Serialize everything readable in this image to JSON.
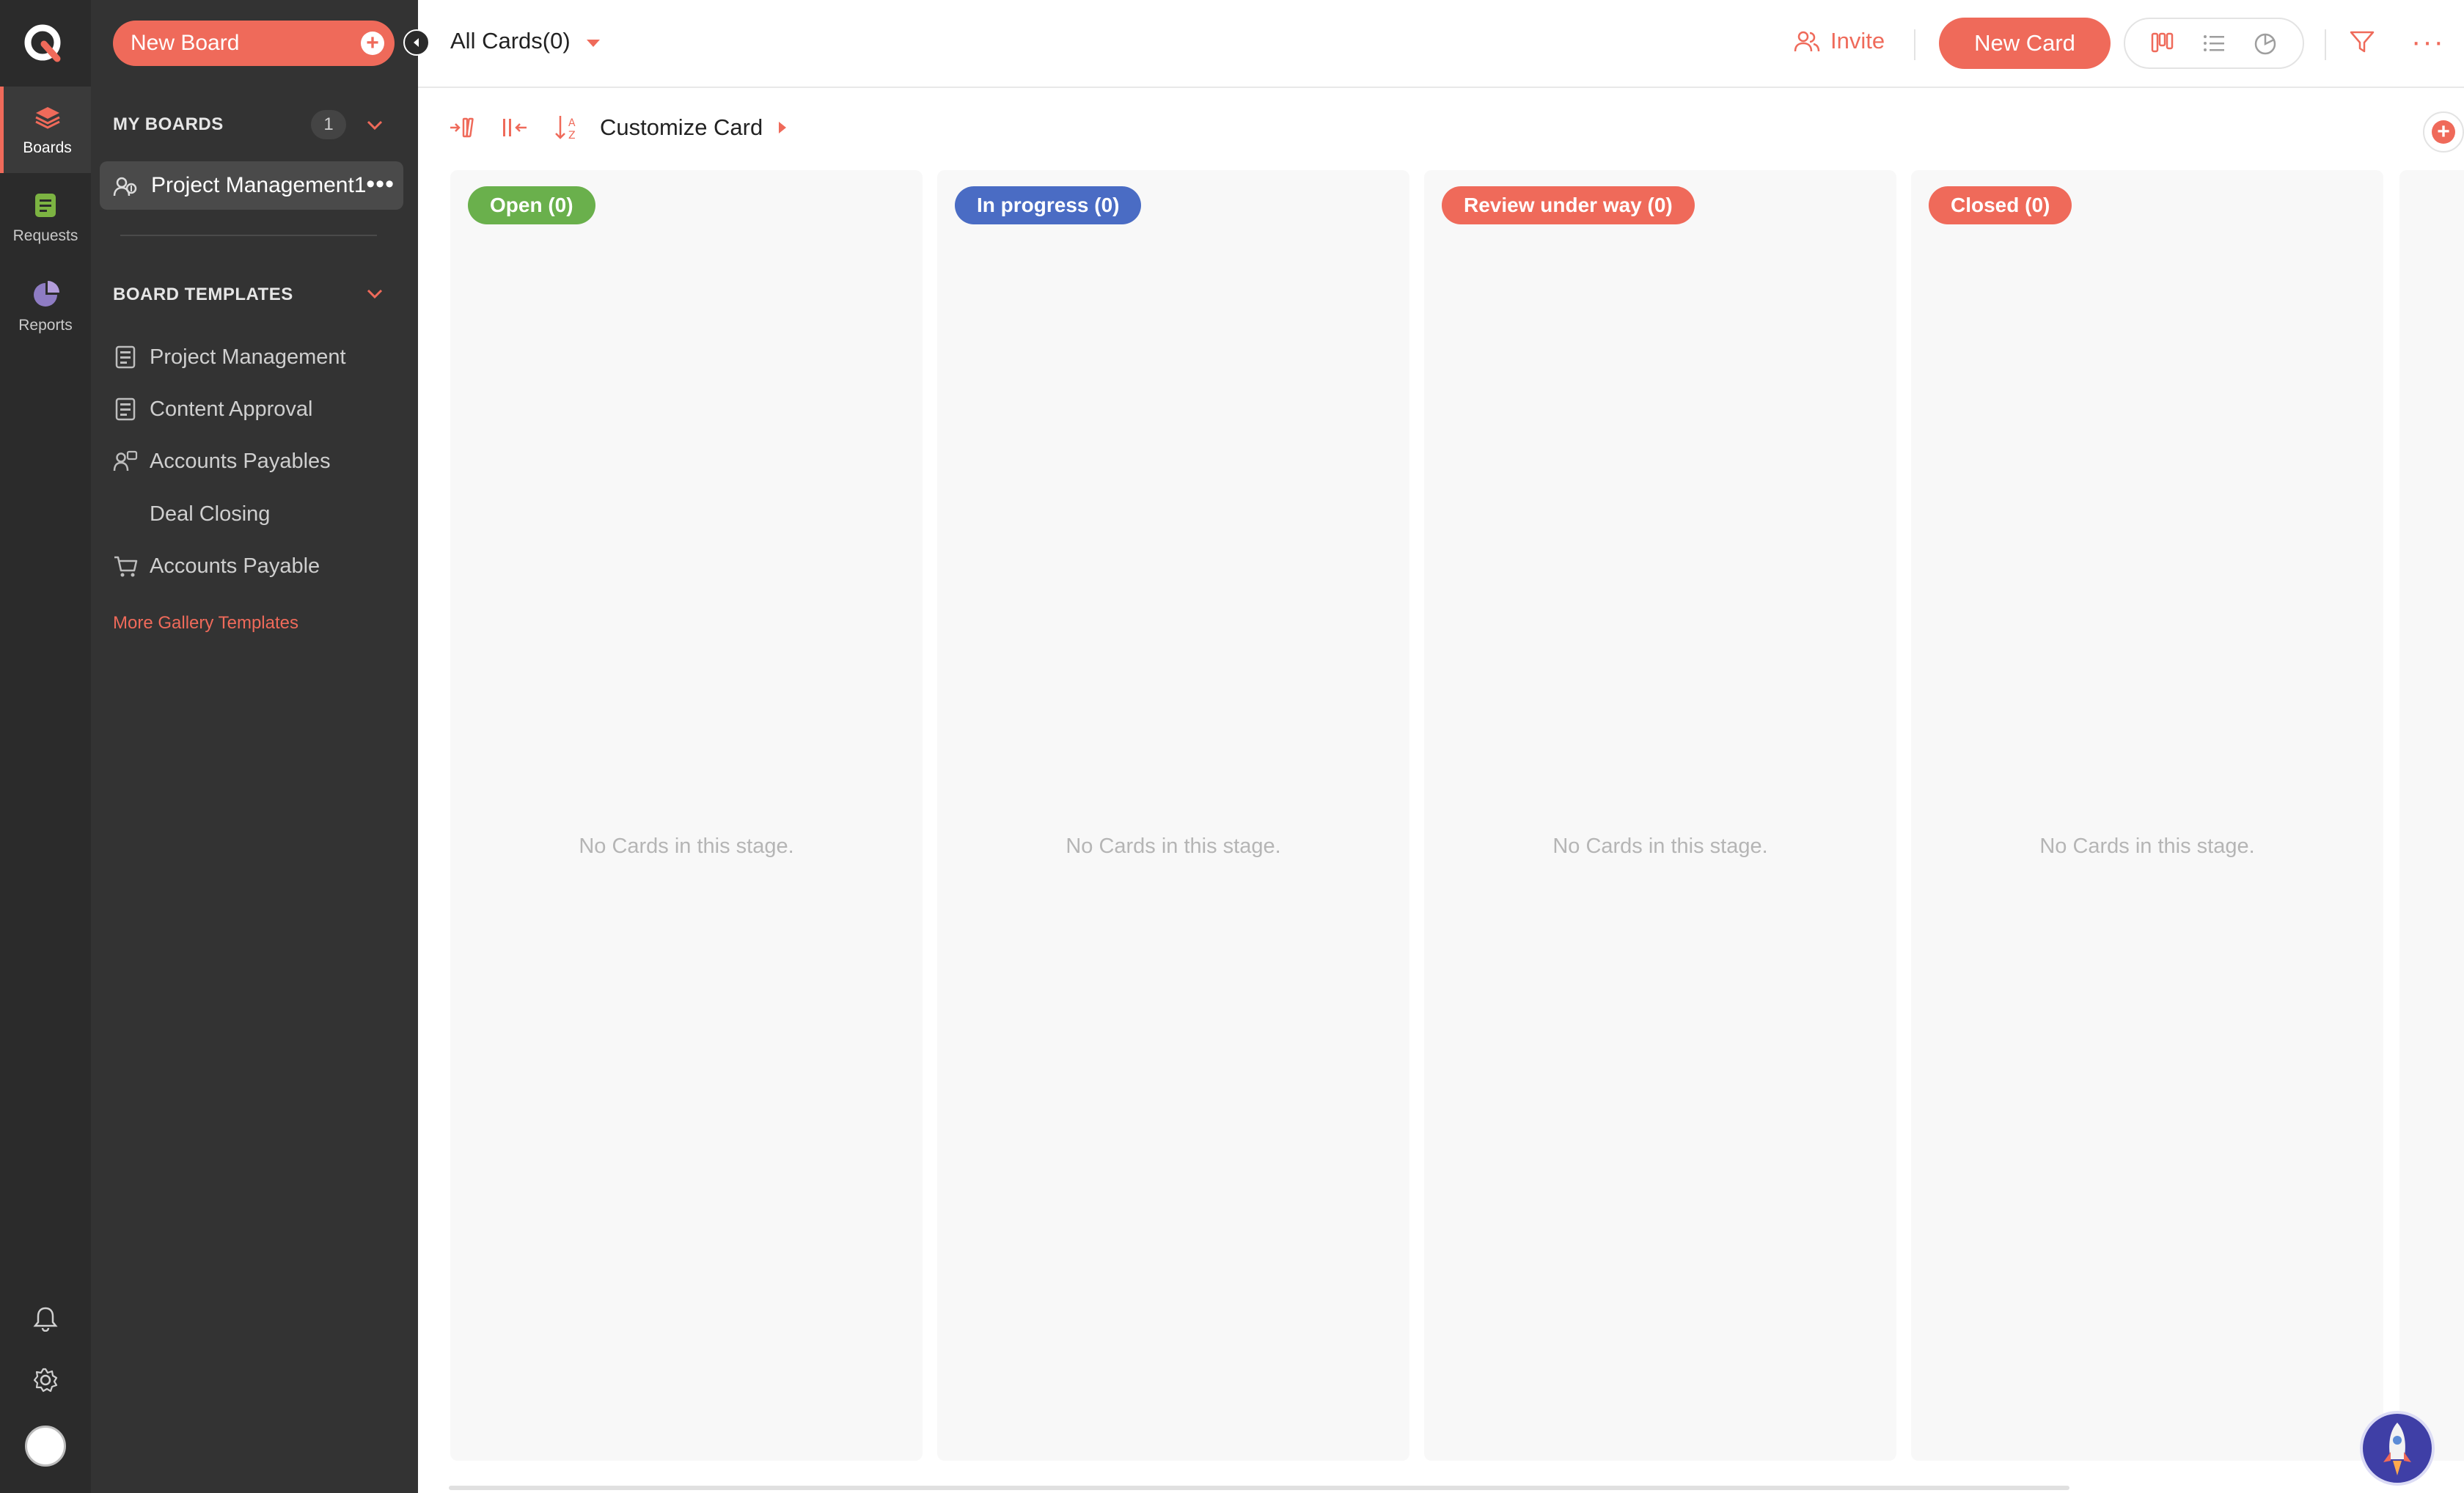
{
  "rail": {
    "items": [
      {
        "label": "Boards",
        "icon": "layers-icon",
        "active": true
      },
      {
        "label": "Requests",
        "icon": "document-icon",
        "active": false
      },
      {
        "label": "Reports",
        "icon": "pie-chart-icon",
        "active": false
      }
    ],
    "bottom": [
      "bell-icon",
      "gear-icon",
      "avatar"
    ]
  },
  "panel": {
    "new_board_label": "New Board",
    "my_boards_heading": "MY BOARDS",
    "my_boards_count": "1",
    "boards": [
      {
        "label": "Project Management1"
      }
    ],
    "templates_heading": "BOARD TEMPLATES",
    "templates": [
      {
        "label": "Project Management",
        "icon": "form-icon"
      },
      {
        "label": "Content Approval",
        "icon": "form-icon"
      },
      {
        "label": "Accounts Payables",
        "icon": "people-money-icon"
      },
      {
        "label": "Deal Closing",
        "icon": ""
      },
      {
        "label": "Accounts Payable",
        "icon": "cart-icon"
      }
    ],
    "more_templates_label": "More Gallery Templates"
  },
  "topbar": {
    "all_cards_label": "All Cards(0)",
    "invite_label": "Invite",
    "new_card_label": "New Card"
  },
  "toolbar": {
    "customize_label": "Customize Card"
  },
  "stages": [
    {
      "tag": "Open  (0)",
      "color": "#6ab04c",
      "empty": "No Cards in this stage."
    },
    {
      "tag": "In progress  (0)",
      "color": "#4a6cc4",
      "empty": "No Cards in this stage."
    },
    {
      "tag": "Review under way  (0)",
      "color": "#ef6a5a",
      "empty": "No Cards in this stage."
    },
    {
      "tag": "Closed  (0)",
      "color": "#ef6a5a",
      "empty": "No Cards in this stage."
    }
  ],
  "colors": {
    "accent": "#ef6a5a",
    "rail_bg": "#2b2b2b",
    "panel_bg": "#333333"
  }
}
